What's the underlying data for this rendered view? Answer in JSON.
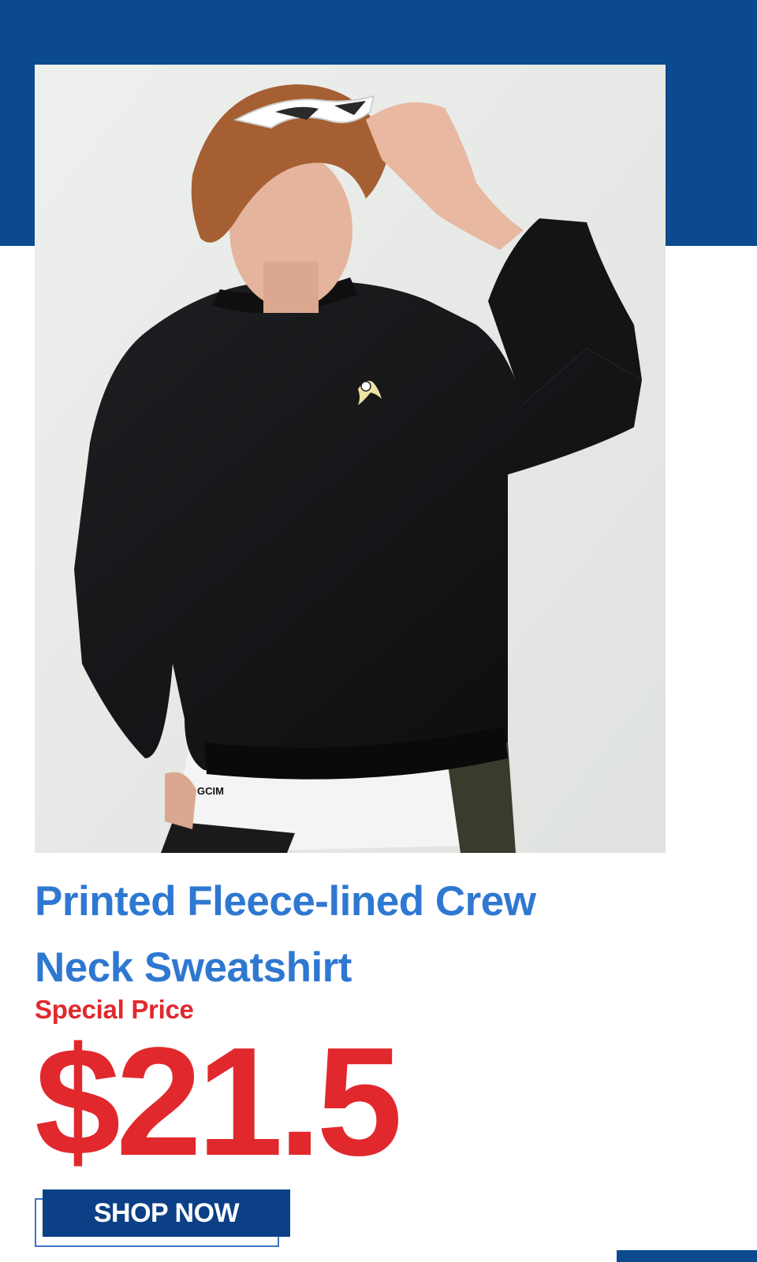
{
  "product": {
    "title_line1": "Printed Fleece-lined Crew",
    "title_line2": "Neck Sweatshirt",
    "price_label": "Special Price",
    "price": "$21.5"
  },
  "cta": {
    "label": "SHOP NOW"
  },
  "photo": {
    "shirt_print": "GCIM",
    "description_icon": "banana-logo-icon"
  },
  "colors": {
    "brand_blue": "#0b4a8e",
    "title_blue": "#2f78d1",
    "price_red": "#e1292d",
    "button_blue": "#0b3f86"
  }
}
